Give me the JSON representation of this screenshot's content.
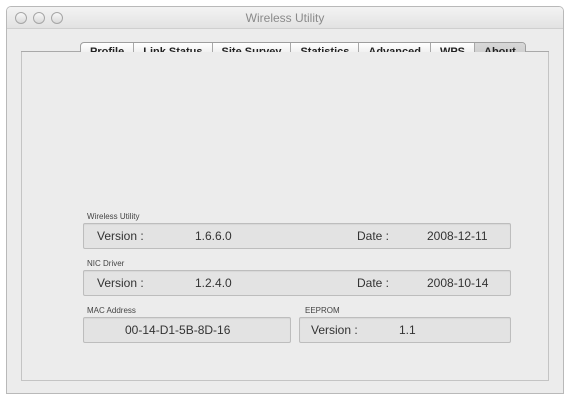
{
  "window": {
    "title": "Wireless Utility"
  },
  "tabs": [
    {
      "label": "Profile"
    },
    {
      "label": "Link Status"
    },
    {
      "label": "Site Survey"
    },
    {
      "label": "Statistics"
    },
    {
      "label": "Advanced"
    },
    {
      "label": "WPS"
    },
    {
      "label": "About",
      "selected": true
    }
  ],
  "about": {
    "wireless_utility": {
      "section_label": "Wireless Utility",
      "version_label": "Version :",
      "version_value": "1.6.6.0",
      "date_label": "Date :",
      "date_value": "2008-12-11"
    },
    "nic_driver": {
      "section_label": "NIC Driver",
      "version_label": "Version :",
      "version_value": "1.2.4.0",
      "date_label": "Date :",
      "date_value": "2008-10-14"
    },
    "mac_address": {
      "section_label": "MAC Address",
      "value": "00-14-D1-5B-8D-16"
    },
    "eeprom": {
      "section_label": "EEPROM",
      "version_label": "Version :",
      "version_value": "1.1"
    }
  }
}
